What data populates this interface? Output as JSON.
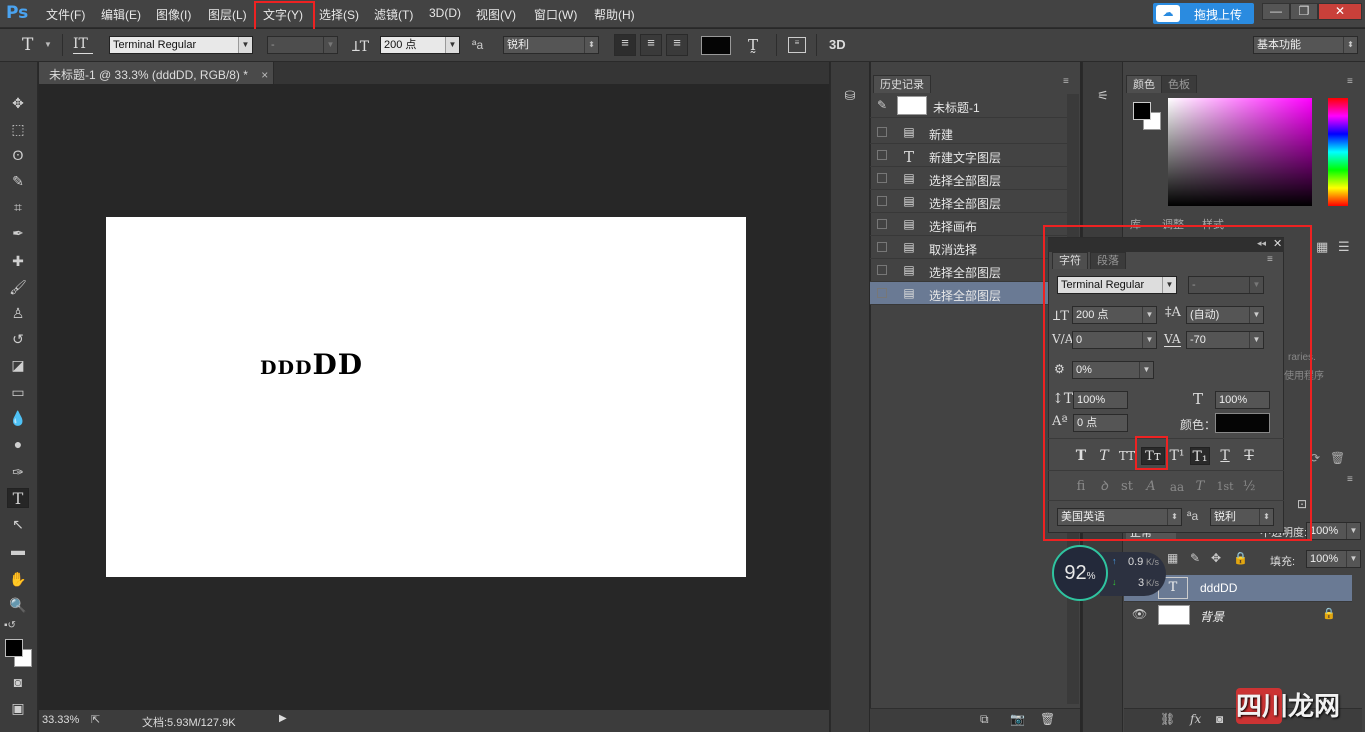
{
  "app": {
    "logo": "Ps"
  },
  "menu": [
    "文件(F)",
    "编辑(E)",
    "图像(I)",
    "图层(L)",
    "文字(Y)",
    "选择(S)",
    "滤镜(T)",
    "3D(D)",
    "视图(V)",
    "窗口(W)",
    "帮助(H)"
  ],
  "upload_button": "拖拽上传",
  "window_controls": {
    "minimize": "—",
    "restore": "❐",
    "close": "✕"
  },
  "options": {
    "font_family": "Terminal Regular",
    "font_style": "-",
    "font_size": "200 点",
    "antialias_label": "ªa",
    "antialias": "锐利",
    "three_d": "3D",
    "workspace": "基本功能"
  },
  "document": {
    "tab_title": "未标题-1 @ 33.3% (dddDD, RGB/8) *",
    "canvas_text_small": "DDD",
    "canvas_text_big": "DD",
    "zoom": "33.33%",
    "doc_info": "文档:5.93M/127.9K"
  },
  "history": {
    "tab": "历史记录",
    "snapshot": "未标题-1",
    "items": [
      {
        "icon": "doc",
        "label": "新建"
      },
      {
        "icon": "T",
        "label": "新建文字图层"
      },
      {
        "icon": "doc",
        "label": "选择全部图层"
      },
      {
        "icon": "doc",
        "label": "选择全部图层"
      },
      {
        "icon": "doc",
        "label": "选择画布"
      },
      {
        "icon": "doc",
        "label": "取消选择"
      },
      {
        "icon": "doc",
        "label": "选择全部图层"
      },
      {
        "icon": "doc",
        "label": "选择全部图层"
      }
    ],
    "selected_index": 7
  },
  "color_panel": {
    "tabs": [
      "颜色",
      "色板"
    ]
  },
  "behind_tabs": [
    "库",
    "调整",
    "样式"
  ],
  "behind_text": [
    "raries.",
    "使用程序"
  ],
  "character": {
    "tabs": [
      "字符",
      "段落"
    ],
    "font_family": "Terminal Regular",
    "font_style": "-",
    "size": "200 点",
    "leading": "(自动)",
    "kerning": "0",
    "tracking": "-70",
    "tsume": "0%",
    "vscale": "100%",
    "hscale": "100%",
    "baseline": "0 点",
    "color_label": "颜色：",
    "language": "美国英语",
    "aa_label": "ªa",
    "antialias": "锐利",
    "type_buttons": [
      "T",
      "T",
      "TT",
      "Tт",
      "T¹",
      "T₁",
      "T",
      "T"
    ],
    "opentype_buttons": [
      "ﬁ",
      "ꝺ",
      "st",
      "A",
      "aa",
      "T",
      "1st",
      "½"
    ]
  },
  "layers": {
    "mode": "正常",
    "opacity_label": "不透明度:",
    "opacity": "100%",
    "fill_label": "填充:",
    "fill": "100%",
    "rows": [
      {
        "name": "dddDD",
        "type": "text"
      },
      {
        "name": "背景",
        "type": "image"
      }
    ]
  },
  "speed": {
    "percent": "92",
    "unit": "%",
    "up": "0.9",
    "up_unit": "K/s",
    "down": "3",
    "down_unit": "K/s"
  },
  "watermark": "四川龙网"
}
